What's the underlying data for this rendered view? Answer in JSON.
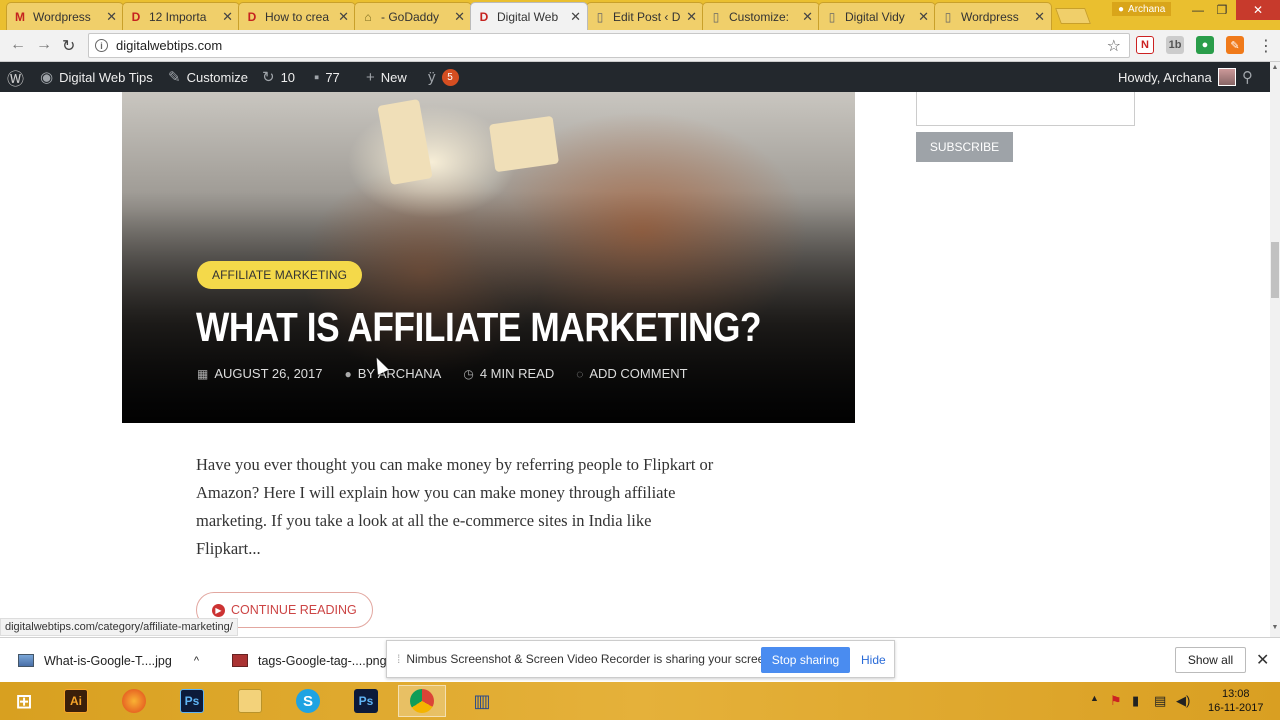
{
  "browser": {
    "tabs": [
      {
        "title": "Wordpress",
        "favicon": "M",
        "color": "#c5221f"
      },
      {
        "title": "12 Importa",
        "favicon": "D",
        "color": "#c5221f"
      },
      {
        "title": "How to crea",
        "favicon": "D",
        "color": "#c5221f"
      },
      {
        "title": "- GoDaddy",
        "favicon": "~",
        "color": "#7a6a1a"
      },
      {
        "title": "Digital Web",
        "favicon": "D",
        "color": "#c5221f",
        "active": true
      },
      {
        "title": "Edit Post ‹ D",
        "favicon": "doc",
        "color": "#666"
      },
      {
        "title": "Customize:",
        "favicon": "doc",
        "color": "#666"
      },
      {
        "title": "Digital Vidy",
        "favicon": "doc",
        "color": "#666"
      },
      {
        "title": "Wordpress",
        "favicon": "doc",
        "color": "#666"
      }
    ],
    "profile_name": "Archana",
    "url": "digitalwebtips.com"
  },
  "adminbar": {
    "site_name": "Digital Web Tips",
    "customize": "Customize",
    "updates": "10",
    "comments": "77",
    "new": "New",
    "yoast_badge": "5",
    "greeting": "Howdy, Archana"
  },
  "post": {
    "category": "AFFILIATE MARKETING",
    "title": "WHAT IS AFFILIATE MARKETING?",
    "date": "AUGUST 26, 2017",
    "author": "BY ARCHANA",
    "read_time": "4 MIN READ",
    "comment_link": "ADD COMMENT",
    "excerpt_lines": [
      "Have you ever thought you can make money by referring people to Flipkart or",
      "Amazon? Here I will explain how you can make money through affiliate",
      "marketing. If you take a look at all the e-commerce sites in India like",
      "Flipkart..."
    ],
    "continue_label": "CONTINUE READING"
  },
  "sidebar": {
    "subscribe_label": "SUBSCRIBE"
  },
  "status_url": "digitalwebtips.com/category/affiliate-marketing/",
  "downloads": {
    "items": [
      {
        "name": "What-is-Google-T....jpg"
      },
      {
        "name": "tags-Google-tag-....png"
      }
    ],
    "share_message": "Nimbus Screenshot & Screen Video Recorder is sharing your screen.",
    "stop_label": "Stop sharing",
    "hide_label": "Hide",
    "show_all_label": "Show all"
  },
  "taskbar": {
    "time": "13:08",
    "date": "16-11-2017"
  },
  "colors": {
    "accent_yellow": "#f4d94a",
    "admin_bar": "#23282d",
    "continue_red": "#cc3333"
  }
}
